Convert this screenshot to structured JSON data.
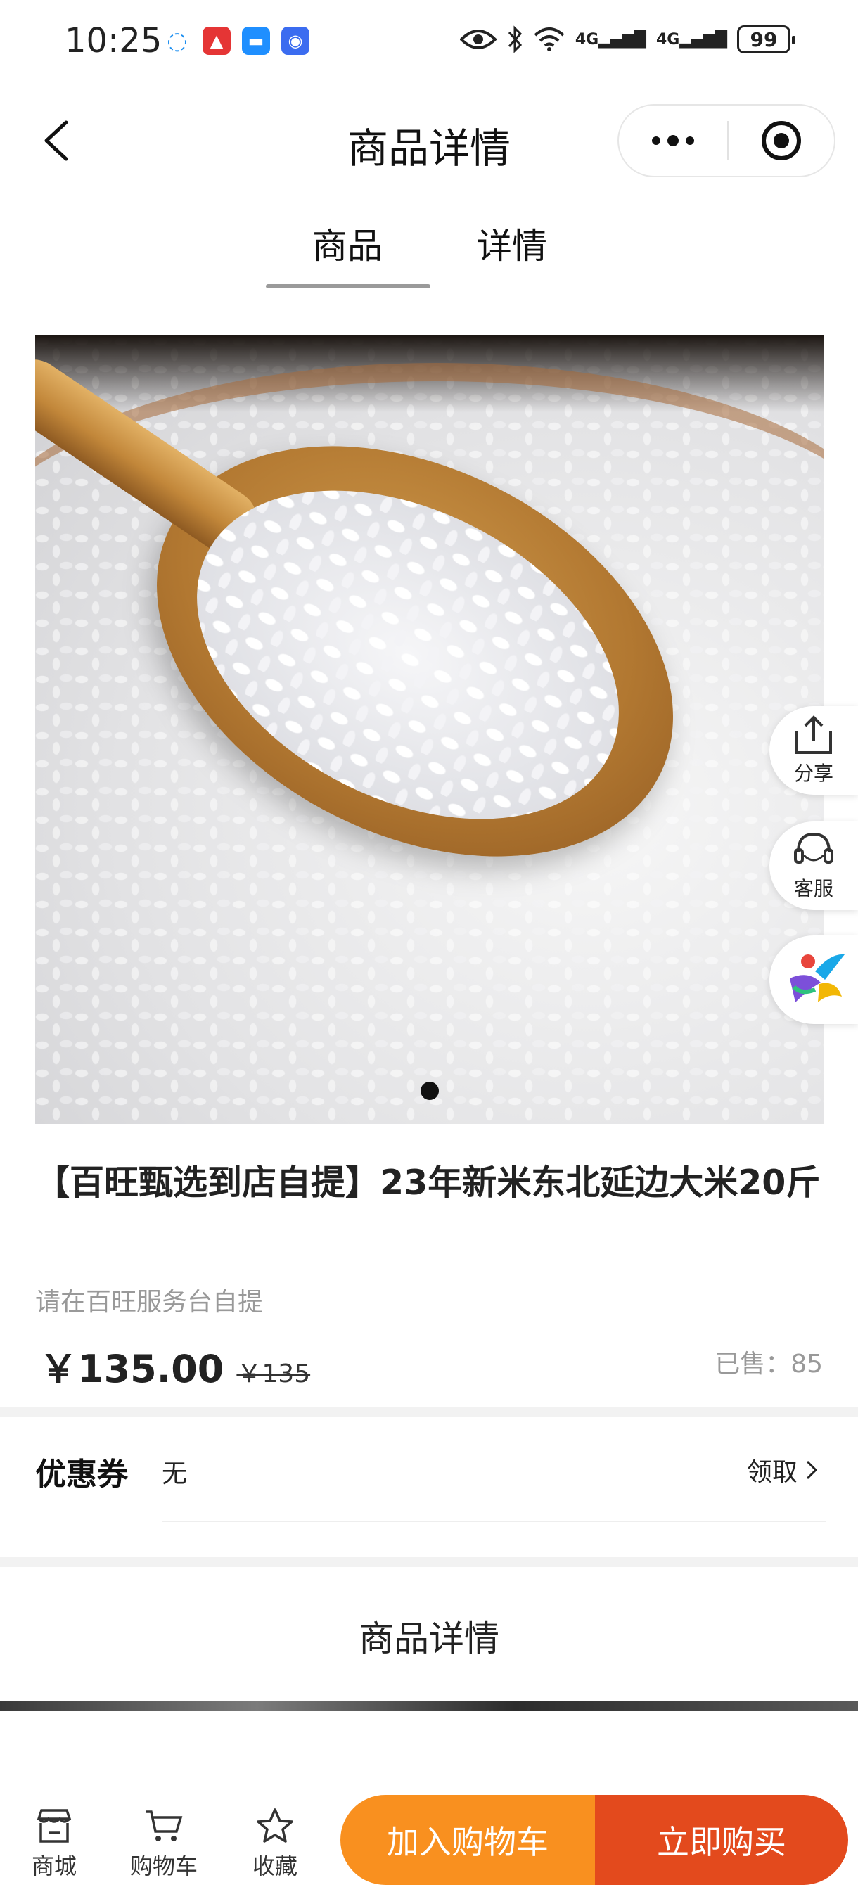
{
  "status_bar": {
    "time": "10:25",
    "signal_1": "4G",
    "signal_2": "4G",
    "battery": "99",
    "icons": [
      "eye-icon",
      "bluetooth-icon",
      "wifi-icon",
      "cellular-icon",
      "battery-icon"
    ],
    "app_icons": [
      "chat-bubble-app-icon",
      "red-app-icon",
      "message-app-icon",
      "blue-app-icon"
    ]
  },
  "nav": {
    "title": "商品详情",
    "icons": [
      "back-arrow-icon",
      "more-dots-icon",
      "close-target-icon"
    ]
  },
  "tabs": [
    {
      "label": "商品",
      "active": true
    },
    {
      "label": "详情",
      "active": false
    }
  ],
  "carousel": {
    "image_subject": "rice on wooden spoon",
    "current_index": 1,
    "total": 1
  },
  "float_buttons": {
    "share_label": "分享",
    "service_label": "客服"
  },
  "product": {
    "title": "【百旺甄选到店自提】23年新米东北延边大米20斤",
    "subtitle": "请在百旺服务台自提",
    "price_current": "￥135.00",
    "price_original": "￥135",
    "sold_text": "已售：85"
  },
  "coupon": {
    "label": "优惠券",
    "value": "无",
    "claim_label": "领取"
  },
  "detail": {
    "heading": "商品详情"
  },
  "bottom_bar": {
    "shop_label": "商城",
    "cart_label": "购物车",
    "fav_label": "收藏",
    "add_cart_label": "加入购物车",
    "buy_now_label": "立即购买",
    "colors": {
      "add_cart": "#f9901f",
      "buy_now": "#e34a1d"
    }
  }
}
